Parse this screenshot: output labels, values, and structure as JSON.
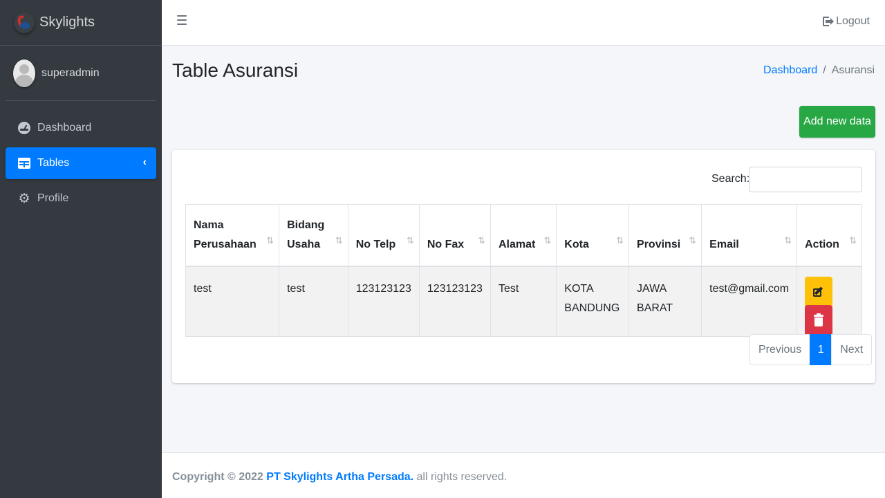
{
  "brand": {
    "name": "Skylights"
  },
  "user": {
    "name": "superadmin"
  },
  "sidebar": {
    "items": [
      {
        "label": "Dashboard",
        "icon": "dashboard-icon",
        "active": false
      },
      {
        "label": "Tables",
        "icon": "table-icon",
        "active": true
      },
      {
        "label": "Profile",
        "icon": "gear-icon",
        "active": false
      }
    ]
  },
  "topbar": {
    "menu_icon": "hamburger-icon",
    "logout_label": "Logout"
  },
  "page": {
    "title": "Table Asuransi",
    "breadcrumb": {
      "home": "Dashboard",
      "separator": "/",
      "current": "Asuransi"
    },
    "add_button": "Add new data"
  },
  "table": {
    "search_label": "Search:",
    "search_value": "",
    "columns": [
      {
        "line1": "Nama",
        "line2": "Perusahaan"
      },
      {
        "line1": "Bidang",
        "line2": "Usaha"
      },
      {
        "line1": "",
        "line2": "No Telp"
      },
      {
        "line1": "",
        "line2": "No Fax"
      },
      {
        "line1": "",
        "line2": "Alamat"
      },
      {
        "line1": "",
        "line2": "Kota"
      },
      {
        "line1": "",
        "line2": "Provinsi"
      },
      {
        "line1": "",
        "line2": "Email"
      },
      {
        "line1": "",
        "line2": "Action"
      }
    ],
    "rows": [
      {
        "nama_perusahaan": "test",
        "bidang_usaha": "test",
        "no_telp": "123123123",
        "no_fax": "123123123",
        "alamat": "Test",
        "kota_line1": "KOTA",
        "kota_line2": "BANDUNG",
        "provinsi_line1": "JAWA",
        "provinsi_line2": "BARAT",
        "email": "test@gmail.com"
      }
    ],
    "sort_glyph": "⇅"
  },
  "pagination": {
    "previous": "Previous",
    "current_page": "1",
    "next": "Next"
  },
  "footer": {
    "prefix": "Copyright © 2022 ",
    "company": "PT Skylights Artha Persada.",
    "suffix": " all rights reserved."
  },
  "colors": {
    "primary": "#007bff",
    "success": "#28a745",
    "warning": "#ffc107",
    "danger": "#dc3545",
    "sidebar": "#343a40"
  }
}
